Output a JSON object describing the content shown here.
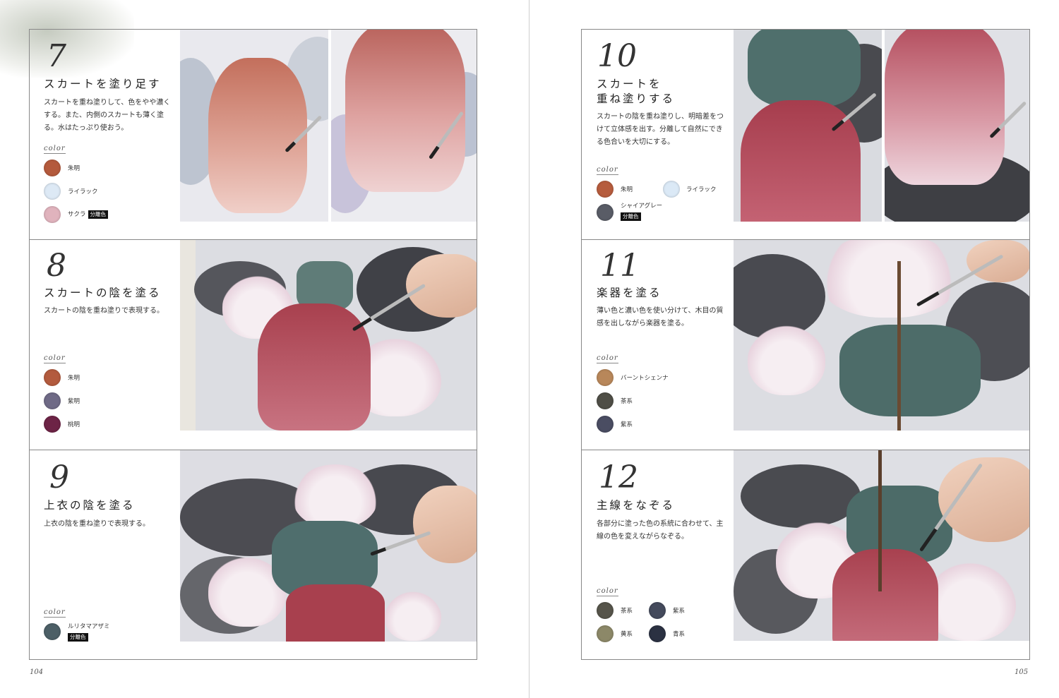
{
  "pages": {
    "left": "104",
    "right": "105"
  },
  "steps": {
    "s7": {
      "num": "7",
      "title": "スカートを塗り足す",
      "desc": "スカートを重ね塗りして、色をやや濃くする。また、内側のスカートも薄く塗る。水はたっぷり使おう。"
    },
    "s8": {
      "num": "8",
      "title": "スカートの陰を塗る",
      "desc": "スカートの陰を重ね塗りで表現する。"
    },
    "s9": {
      "num": "9",
      "title": "上衣の陰を塗る",
      "desc": "上衣の陰を重ね塗りで表現する。"
    },
    "s10": {
      "num": "10",
      "title1": "スカートを",
      "title2": "重ね塗りする",
      "desc": "スカートの陰を重ね塗りし、明暗差をつけて立体感を出す。分離して自然にできる色合いを大切にする。"
    },
    "s11": {
      "num": "11",
      "title": "楽器を塗る",
      "desc": "薄い色と濃い色を使い分けて、木目の質感を出しながら楽器を塗る。"
    },
    "s12": {
      "num": "12",
      "title": "主線をなぞる",
      "desc": "各部分に塗った色の系統に合わせて、主線の色を変えながらなぞる。"
    }
  },
  "color_label": "color",
  "badge": "分離色",
  "palettes": {
    "s7": [
      {
        "name": "朱明",
        "hex": "#b45a3c"
      },
      {
        "name": "ライラック",
        "hex": "#dde9f5"
      },
      {
        "name": "サクラ",
        "hex": "#e0b3bd"
      }
    ],
    "s8": [
      {
        "name": "朱明",
        "hex": "#b35b3e"
      },
      {
        "name": "紫明",
        "hex": "#6f6a86"
      },
      {
        "name": "桃明",
        "hex": "#6d2446"
      }
    ],
    "s9": [
      {
        "name": "ルリタマアザミ",
        "hex": "#4c5f66"
      }
    ],
    "s10": [
      {
        "name": "朱明",
        "hex": "#b65c3d"
      },
      {
        "name": "ライラック",
        "hex": "#dbe9f6"
      },
      {
        "name": "シャイアグレー",
        "hex": "#595c66"
      }
    ],
    "s11": [
      {
        "name": "バーントシェンナ",
        "hex": "#b8875a"
      },
      {
        "name": "茶系",
        "hex": "#4f4e46"
      },
      {
        "name": "紫系",
        "hex": "#4a4d62"
      }
    ],
    "s12": [
      {
        "name": "茶系",
        "hex": "#56544a"
      },
      {
        "name": "紫系",
        "hex": "#444a5c"
      },
      {
        "name": "黄系",
        "hex": "#8c8868"
      },
      {
        "name": "青系",
        "hex": "#2b3142"
      }
    ]
  }
}
